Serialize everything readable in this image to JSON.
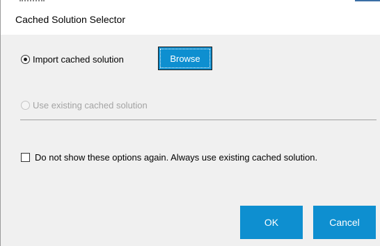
{
  "window": {
    "title": "Cached Solution Selector"
  },
  "options": {
    "import": {
      "label": "Import cached solution",
      "selected": true,
      "enabled": true
    },
    "browse_label": "Browse",
    "use_existing": {
      "label": "Use existing cached solution",
      "selected": false,
      "enabled": false
    }
  },
  "dont_show": {
    "label": "Do not show these options again. Always use existing cached solution.",
    "checked": false
  },
  "buttons": {
    "ok_label": "OK",
    "cancel_label": "Cancel"
  },
  "colors": {
    "accent": "#0e8fd0",
    "panel_background": "#f0f0f0",
    "disabled_text": "#a3a3a3"
  }
}
